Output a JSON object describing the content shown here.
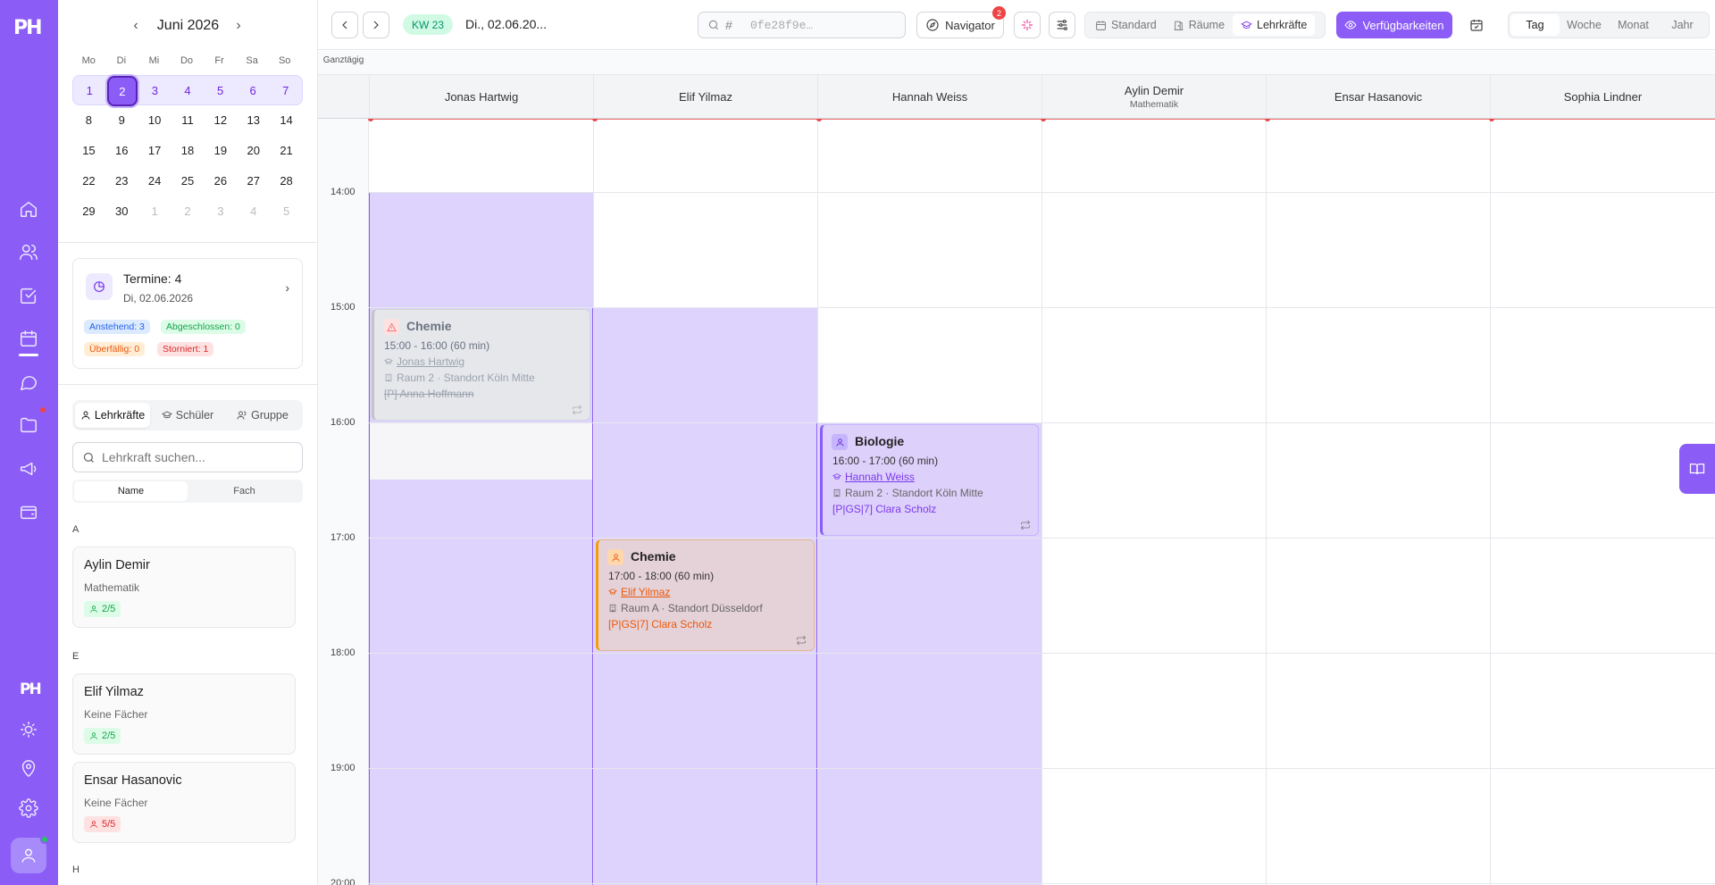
{
  "colors": {
    "accent": "#8b5cf6",
    "accent_light": "#ede9fe",
    "now_line": "#ef4444",
    "cancel": "#9ca3af",
    "orange": "#f59e0b"
  },
  "rail": {
    "logo": "PH",
    "icons": [
      "home-icon",
      "users-icon",
      "tasks-icon",
      "calendar-icon",
      "chat-icon",
      "folder-icon",
      "megaphone-icon",
      "wallet-icon"
    ],
    "bottom_logo": "PH",
    "bottom_icons": [
      "sun-icon",
      "map-pin-icon",
      "settings-icon",
      "user-icon"
    ]
  },
  "mini_calendar": {
    "month_label": "Juni 2026",
    "weekdays": [
      "Mo",
      "Di",
      "Mi",
      "Do",
      "Fr",
      "Sa",
      "So"
    ],
    "weeks": [
      [
        "1",
        "2",
        "3",
        "4",
        "5",
        "6",
        "7"
      ],
      [
        "8",
        "9",
        "10",
        "11",
        "12",
        "13",
        "14"
      ],
      [
        "15",
        "16",
        "17",
        "18",
        "19",
        "20",
        "21"
      ],
      [
        "22",
        "23",
        "24",
        "25",
        "26",
        "27",
        "28"
      ],
      [
        "29",
        "30",
        "1",
        "2",
        "3",
        "4",
        "5"
      ]
    ],
    "selected_day": "2"
  },
  "summary": {
    "title": "Termine: 4",
    "date": "Di, 02.06.2026",
    "badges": {
      "pending": "Anstehend: 3",
      "done": "Abgeschlossen: 0",
      "overdue": "Überfällig: 0",
      "cancelled": "Storniert: 1"
    }
  },
  "filter_tabs": {
    "teachers": "Lehrkräfte",
    "students": "Schüler",
    "group": "Gruppe"
  },
  "teacher_search": {
    "placeholder": "Lehrkraft suchen..."
  },
  "sort_tabs": {
    "name": "Name",
    "subject": "Fach"
  },
  "teacher_list": {
    "groups": [
      {
        "letter": "A",
        "items": [
          {
            "name": "Aylin Demir",
            "subject": "Mathematik",
            "capacity": "2/5"
          }
        ]
      },
      {
        "letter": "E",
        "items": [
          {
            "name": "Elif Yilmaz",
            "subject": "Keine Fächer",
            "capacity": "2/5"
          },
          {
            "name": "Ensar Hasanovic",
            "subject": "Keine Fächer",
            "capacity": "5/5"
          }
        ]
      },
      {
        "letter": "H",
        "items": []
      }
    ]
  },
  "topbar": {
    "week_badge": "KW 23",
    "date_label": "Di., 02.06.20...",
    "search_hash": "#",
    "search_placeholder": "0fe28f9e…",
    "navigator_label": "Navigator",
    "navigator_count": "2",
    "view_tabs": {
      "standard": "Standard",
      "rooms": "Räume",
      "teachers": "Lehrkräfte"
    },
    "availability_label": "Verfügbarkeiten",
    "range_tabs": {
      "day": "Tag",
      "week": "Woche",
      "month": "Monat",
      "year": "Jahr"
    }
  },
  "schedule": {
    "allday_label": "Ganztägig",
    "columns": [
      {
        "name": "Jonas Hartwig",
        "subject": ""
      },
      {
        "name": "Elif Yilmaz",
        "subject": ""
      },
      {
        "name": "Hannah Weiss",
        "subject": ""
      },
      {
        "name": "Aylin Demir",
        "subject": "Mathematik"
      },
      {
        "name": "Ensar Hasanovic",
        "subject": ""
      },
      {
        "name": "Sophia Lindner",
        "subject": ""
      }
    ],
    "hours": [
      "14:00",
      "15:00",
      "16:00",
      "17:00",
      "18:00",
      "19:00",
      "20:00"
    ],
    "events": {
      "chemie_cancelled": {
        "title": "Chemie",
        "time": "15:00 - 16:00 (60 min)",
        "teacher": "Jonas Hartwig",
        "room": "Raum 2 · Standort Köln Mitte",
        "student": "[P] Anna Hoffmann",
        "status": "cancelled"
      },
      "chemie": {
        "title": "Chemie",
        "time": "17:00 - 18:00 (60 min)",
        "teacher": "Elif Yilmaz",
        "room": "Raum A · Standort Düsseldorf",
        "student": "[P|GS|7] Clara Scholz"
      },
      "biologie": {
        "title": "Biologie",
        "time": "16:00 - 17:00 (60 min)",
        "teacher": "Hannah Weiss",
        "room": "Raum 2 · Standort Köln Mitte",
        "student": "[P|GS|7] Clara Scholz"
      }
    }
  }
}
